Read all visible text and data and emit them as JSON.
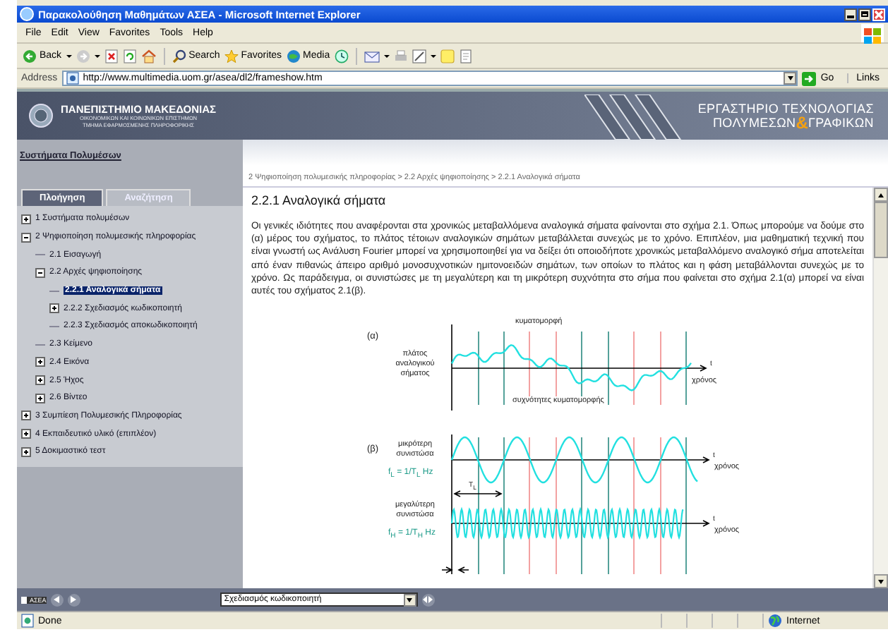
{
  "window": {
    "title": "Παρακολούθηση Μαθημάτων ΑΣΕΑ - Microsoft Internet Explorer"
  },
  "menu": [
    "File",
    "Edit",
    "View",
    "Favorites",
    "Tools",
    "Help"
  ],
  "toolbar": [
    {
      "kind": "back",
      "label": "Back"
    },
    {
      "kind": "search",
      "label": "Search"
    },
    {
      "kind": "favorites",
      "label": "Favorites"
    },
    {
      "kind": "media",
      "label": "Media"
    }
  ],
  "address": {
    "label": "Address",
    "value": "http://www.multimedia.uom.gr/asea/dl2/frameshow.htm",
    "go": "Go",
    "links": "Links"
  },
  "header": {
    "university": "ΠΑΝΕΠΙΣΤΗΜΙΟ ΜΑΚΕΔΟΝΙΑΣ",
    "school": "ΟΙΚΟΝΟΜΙΚΩΝ ΚΑΙ ΚΟΙΝΩΝΙΚΩΝ ΕΠΙΣΤΗΜΩΝ",
    "department": "ΤΜΗΜΑ ΕΦΑΡΜΟΣΜΕΝΗΣ ΠΛΗΡΟΦΟΡΙΚΗΣ",
    "lab_line_1": "ΕΡΓΑΣΤΗΡΙΟ ΤΕΧΝΟΛΟΓΙΑΣ",
    "lab_line_2a": "ΠΟΛΥΜΕΣΩΝ",
    "lab_amp": "&",
    "lab_line_2b": "ΓΡΑΦΙΚΩΝ"
  },
  "sidebar": {
    "title": "Συστήματα Πολυμέσων",
    "tabs": [
      {
        "label": "Πλοήγηση",
        "selected": true
      },
      {
        "label": "Αναζήτηση",
        "selected": false
      }
    ],
    "tree": [
      {
        "label": "1 Συστήματα πολυμέσων",
        "expanded": false,
        "selected": false
      },
      {
        "label": "2 Ψηφιοποίηση πολυμεσικής πληροφορίας",
        "expanded": true,
        "selected": false,
        "children": [
          {
            "label": "2.1 Εισαγωγή",
            "selected": false
          },
          {
            "label": "2.2 Αρχές ψηφιοποίησης",
            "expanded": true,
            "selected": false,
            "children": [
              {
                "label": "2.2.1 Αναλογικά σήματα",
                "selected": true
              },
              {
                "label": "2.2.2 Σχεδιασμός κωδικοποιητή",
                "expanded": false,
                "selected": false
              },
              {
                "label": "2.2.3 Σχεδιασμός αποκωδικοποιητή",
                "selected": false
              }
            ]
          },
          {
            "label": "2.3 Κείμενο",
            "selected": false
          },
          {
            "label": "2.4 Εικόνα",
            "expanded": false,
            "selected": false
          },
          {
            "label": "2.5 Ήχος",
            "expanded": false,
            "selected": false
          },
          {
            "label": "2.6 Βίντεο",
            "expanded": false,
            "selected": false
          }
        ]
      },
      {
        "label": "3 Συμπίεση Πολυμεσικής Πληροφορίας",
        "expanded": false,
        "selected": false
      },
      {
        "label": "4 Εκπαιδευτικό υλικό (επιπλέον)",
        "expanded": false,
        "selected": false
      },
      {
        "label": "5 Δοκιμαστικό τεστ",
        "expanded": false,
        "selected": false
      }
    ]
  },
  "content": {
    "breadcrumb": "2 Ψηφιοποίηση πολυμεσικής πληροφορίας > 2.2 Αρχές ψηφιοποίησης >  2.2.1 Αναλογικά σήματα",
    "heading": "2.2.1 Αναλογικά σήματα",
    "paragraph": "Οι γενικές ιδιότητες που αναφέρονται στα χρονικώς μεταβαλλόμενα αναλογικά σήματα φαίνονται στο σχήμα 2.1. Όπως μπορούμε να δούμε στο (α) μέρος του σχήματος, το πλάτος τέτοιων αναλογικών σημάτων μεταβάλλεται συνεχώς με το χρόνο. Επιπλέον, μια μαθηματική τεχνική που είναι γνωστή ως Ανάλυση Fourier μπορεί να χρησιμοποιηθεί για να δείξει ότι οποιοδήποτε χρονικώς μεταβαλλόμενο αναλογικό σήμα αποτελείται από έναν πιθανώς άπειρο αριθμό μονοσυχνοτικών ημιτονοειδών σημάτων, των οποίων το πλάτος και η φάση μεταβάλλονται συνεχώς με το χρόνο. Ως παράδειγμα, οι συνιστώσες με τη μεγαλύτερη και τη μικρότερη συχνότητα στο σήμα που φαίνεται στο σχήμα 2.1(α) μπορεί να είναι αυτές του σχήματος 2.1(β).",
    "figure": {
      "panel_a": {
        "tag": "(α)",
        "title": "κυματομορφή",
        "ylabel": "πλάτος αναλογικού σήματος",
        "axis": "t",
        "xlabel": "χρόνος",
        "caption": "συχνότητες κυματομορφής"
      },
      "panel_b": {
        "tag": "(β)",
        "low_label": "μικρότερη συνιστώσα",
        "low_formula": "f$_{L}$ = 1/T$_{L}$ Hz",
        "low_axis": "t",
        "low_xlabel": "χρόνος",
        "low_period": "T$_{L}$",
        "high_label": "μεγαλύτερη συνιστώσα",
        "high_formula": "f$_{H}$ = 1/T$_{H}$ Hz",
        "high_axis": "t",
        "high_xlabel": "χρόνος"
      }
    }
  },
  "nav_bar": {
    "logo": "ΑΣΕΑ",
    "select_value": "Σχεδιασμός κωδικοποιητή"
  },
  "status_bar": {
    "text": "Done",
    "zone": "Internet"
  }
}
